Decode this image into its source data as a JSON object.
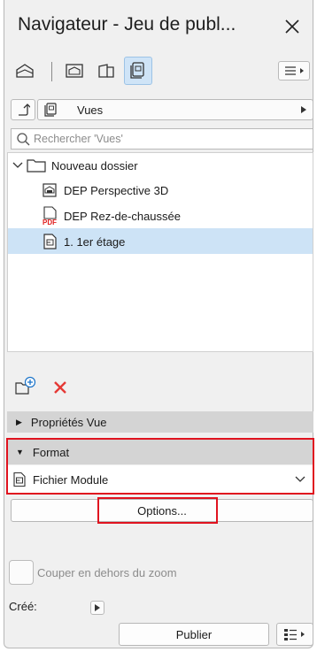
{
  "window": {
    "title": "Navigateur - Jeu de publ..."
  },
  "toolbar": {
    "icons": [
      "project-map-icon",
      "view-map-icon",
      "layout-book-icon",
      "publisher-sets-icon",
      "menu-icon"
    ],
    "selected": "publisher-sets-icon"
  },
  "view_selector": {
    "label": "Vues"
  },
  "search": {
    "placeholder": "Rechercher 'Vues'"
  },
  "tree": {
    "folder": {
      "label": "Nouveau dossier",
      "icon": "folder-icon"
    },
    "items": [
      {
        "label": "DEP Perspective 3D",
        "icon": "dwg-file-icon"
      },
      {
        "label": "DEP Rez-de-chaussée",
        "icon": "pdf-file-icon"
      },
      {
        "label": "1. 1er étage",
        "icon": "module-file-icon",
        "selected": true
      }
    ]
  },
  "actions": {
    "icons": [
      "new-subset-icon",
      "delete-icon"
    ]
  },
  "sections": {
    "view_props": "Propriétés Vue",
    "format": "Format"
  },
  "format": {
    "selected": "Fichier Module",
    "options_button": "Options..."
  },
  "clip": {
    "label": "Couper en dehors du zoom",
    "checked": false
  },
  "created": {
    "label": "Créé:"
  },
  "footer": {
    "publish_button": "Publier"
  },
  "colors": {
    "accent": "#cde3f6",
    "highlight": "#e0131f",
    "delete": "#e53935"
  }
}
